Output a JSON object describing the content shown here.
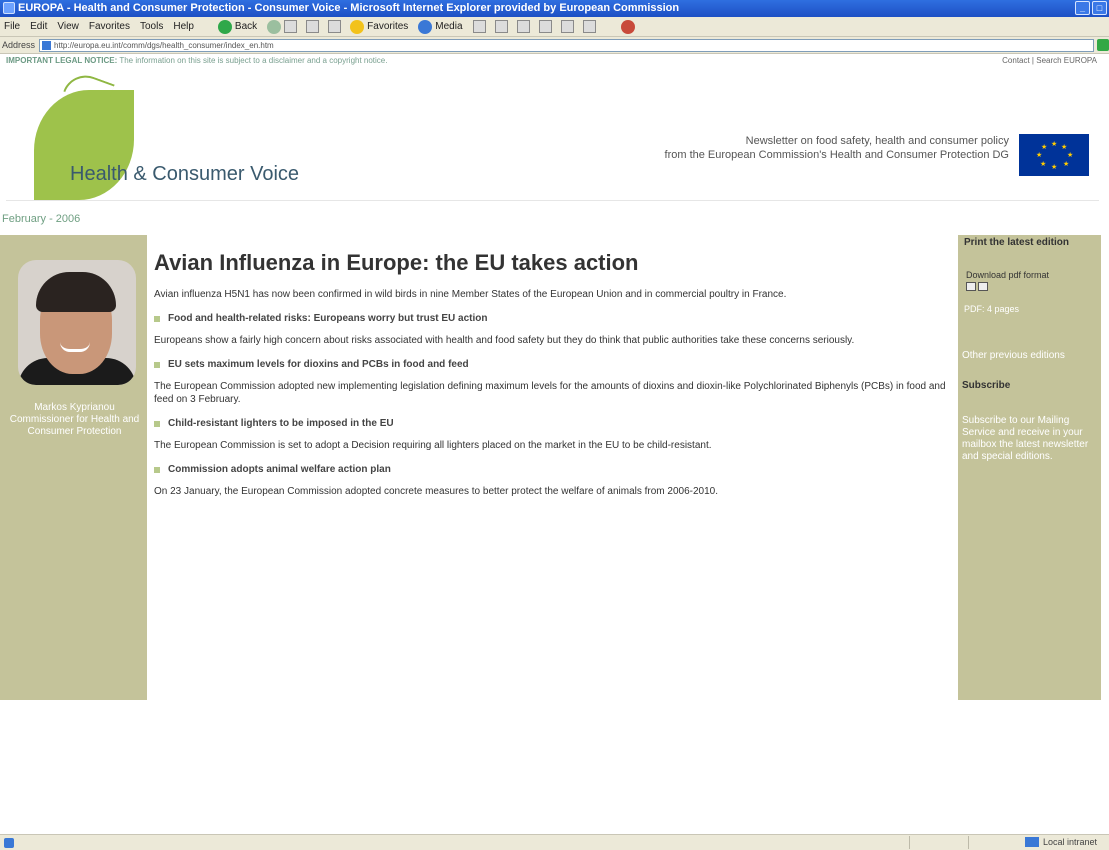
{
  "window": {
    "title": "EUROPA - Health and Consumer Protection - Consumer Voice - Microsoft Internet Explorer provided by European Commission"
  },
  "menu": {
    "items": [
      "File",
      "Edit",
      "View",
      "Favorites",
      "Tools",
      "Help"
    ],
    "toolbar": {
      "back": "Back",
      "favorites": "Favorites",
      "media": "Media"
    }
  },
  "address": {
    "label": "Address",
    "url": "http://europa.eu.int/comm/dgs/health_consumer/index_en.htm"
  },
  "page": {
    "legal_bold": "IMPORTANT LEGAL NOTICE:",
    "legal_text": "The information on this site is subject to a disclaimer and a copyright notice.",
    "toplinks": "Contact | Search EUROPA",
    "brand": "Health & Consumer Voice",
    "tagline_1": "Newsletter on food safety, health and consumer policy",
    "tagline_2": "from the European Commission's Health and Consumer Protection DG",
    "edition": "February - 2006",
    "caption": "Markos Kyprianou Commissioner for Health and Consumer Protection",
    "headline": "Avian Influenza in Europe: the EU takes action",
    "intro": "Avian influenza H5N1 has now been confirmed in wild birds in nine Member States of the European Union and in commercial poultry in France.",
    "items": [
      {
        "title": "Food and health-related risks: Europeans worry but trust EU action",
        "text": "Europeans show a fairly high concern about risks associated with health and food safety but they do think that public authorities take these concerns seriously."
      },
      {
        "title": "EU sets maximum levels for dioxins and PCBs in food and feed",
        "text": "The European Commission adopted new implementing legislation defining maximum levels for the amounts of dioxins and dioxin-like Polychlorinated Biphenyls (PCBs) in food and feed on 3 February."
      },
      {
        "title": "Child-resistant lighters to be imposed in the EU",
        "text": "The European Commission is set to adopt a Decision requiring all lighters placed on the market in the EU to be child-resistant."
      },
      {
        "title": "Commission adopts animal welfare action plan",
        "text": "On 23 January, the European Commission adopted concrete measures to better protect the welfare of animals from 2006-2010."
      }
    ],
    "right": {
      "heading": "Print the latest edition",
      "download": "Download pdf format",
      "pdf_size": "PDF: 4 pages",
      "previous": "Other previous editions",
      "subscribe": "Subscribe",
      "subscribe_text": "Subscribe to our Mailing Service and receive in your mailbox the latest newsletter and special editions."
    }
  },
  "status": {
    "zone": "Local intranet"
  }
}
